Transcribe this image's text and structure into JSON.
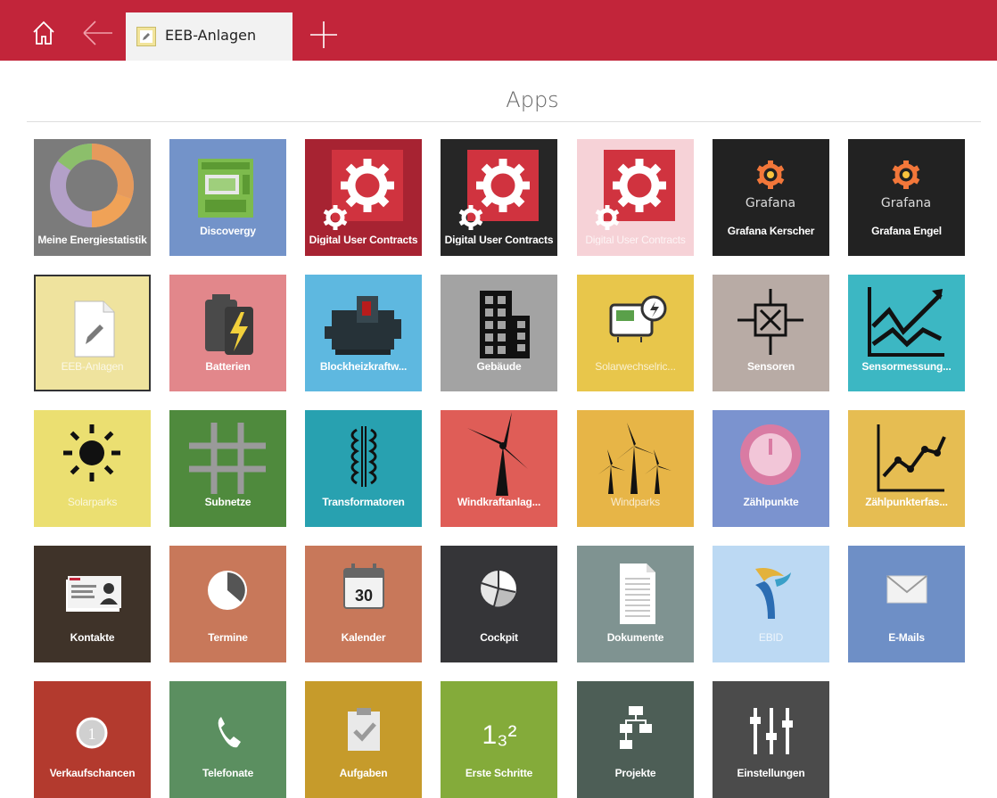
{
  "header": {
    "tab_label": "EEB-Anlagen"
  },
  "page": {
    "title": "Apps"
  },
  "colors": {
    "brand": "#c2253a"
  },
  "tiles": [
    {
      "label": "Meine Energiestatistik",
      "color": "#7b7b7b",
      "icon": "donut-chart-icon"
    },
    {
      "label": "Discovergy",
      "color": "#7393c9",
      "icon": "smart-meter-icon"
    },
    {
      "label": "Digital User Contracts",
      "color": "#a72332",
      "icon": "gear-icon"
    },
    {
      "label": "Digital User Contracts",
      "color": "#262626",
      "icon": "gear-icon"
    },
    {
      "label": "Digital User Contracts",
      "color": "#f6d2d7",
      "icon": "gear-icon"
    },
    {
      "label": "Grafana Kerscher",
      "color": "#222222",
      "icon": "grafana-logo-icon",
      "brand": "Grafana"
    },
    {
      "label": "Grafana Engel",
      "color": "#222222",
      "icon": "grafana-logo-icon",
      "brand": "Grafana"
    },
    {
      "label": "EEB-Anlagen",
      "color": "#efe39e",
      "icon": "edit-document-icon"
    },
    {
      "label": "Batterien",
      "color": "#e2878b",
      "icon": "battery-icon"
    },
    {
      "label": "Blockheizkraftw...",
      "color": "#5eb8e0",
      "icon": "generator-icon"
    },
    {
      "label": "Gebäude",
      "color": "#a3a3a3",
      "icon": "building-icon"
    },
    {
      "label": "Solarwechselric...",
      "color": "#e8c64b",
      "icon": "inverter-icon"
    },
    {
      "label": "Sensoren",
      "color": "#b8aba5",
      "icon": "sensor-icon"
    },
    {
      "label": "Sensormessung...",
      "color": "#3cb7c3",
      "icon": "line-chart-icon"
    },
    {
      "label": "Solarparks",
      "color": "#ebdf71",
      "icon": "sun-icon"
    },
    {
      "label": "Subnetze",
      "color": "#4f8a3d",
      "icon": "grid-hash-icon"
    },
    {
      "label": "Transformatoren",
      "color": "#28a1b0",
      "icon": "transformer-icon"
    },
    {
      "label": "Windkraftanlag...",
      "color": "#df5d57",
      "icon": "wind-turbine-icon"
    },
    {
      "label": "Windparks",
      "color": "#e7b547",
      "icon": "wind-park-icon"
    },
    {
      "label": "Zählpunkte",
      "color": "#7b93cf",
      "icon": "gauge-icon"
    },
    {
      "label": "Zählpunkterfas...",
      "color": "#e6bd52",
      "icon": "trend-chart-icon"
    },
    {
      "label": "Kontakte",
      "color": "#3f3329",
      "icon": "contact-card-icon"
    },
    {
      "label": "Termine",
      "color": "#c8785a",
      "icon": "clock-icon"
    },
    {
      "label": "Kalender",
      "color": "#c8785a",
      "icon": "calendar-icon",
      "day": "30"
    },
    {
      "label": "Cockpit",
      "color": "#353538",
      "icon": "pie-chart-icon"
    },
    {
      "label": "Dokumente",
      "color": "#7f9391",
      "icon": "document-icon"
    },
    {
      "label": "EBID",
      "color": "#bcd9f3",
      "icon": "ebid-logo-icon"
    },
    {
      "label": "E-Mails",
      "color": "#6e8fc6",
      "icon": "envelope-icon"
    },
    {
      "label": "Verkaufschancen",
      "color": "#b33a2e",
      "icon": "coin-icon",
      "badge": "1"
    },
    {
      "label": "Telefonate",
      "color": "#5b8f60",
      "icon": "phone-icon"
    },
    {
      "label": "Aufgaben",
      "color": "#c69b2b",
      "icon": "clipboard-check-icon"
    },
    {
      "label": "Erste Schritte",
      "color": "#84ab3a",
      "icon": "first-steps-icon",
      "glyph": "1₃²"
    },
    {
      "label": "Projekte",
      "color": "#4d5e56",
      "icon": "project-tree-icon"
    },
    {
      "label": "Einstellungen",
      "color": "#4b4b4b",
      "icon": "sliders-icon"
    }
  ]
}
